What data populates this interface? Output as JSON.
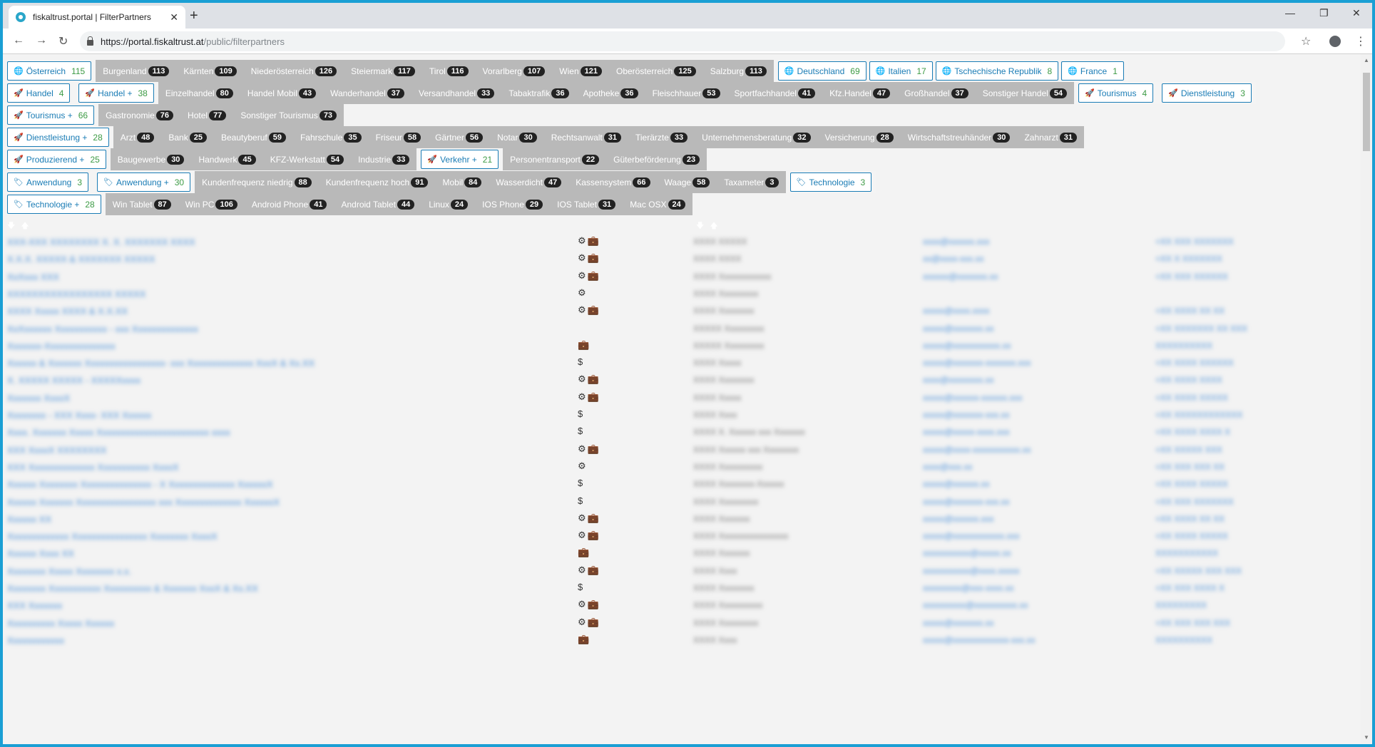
{
  "browser": {
    "tab_title": "fiskaltrust.portal | FilterPartners",
    "url_host": "https://portal.fiskaltrust.at",
    "url_path": "/public/filterpartners"
  },
  "filters": {
    "row1": {
      "oesterreich": {
        "label": "Österreich",
        "count": "115"
      },
      "items": [
        {
          "label": "Burgenland",
          "count": "113"
        },
        {
          "label": "Kärnten",
          "count": "109"
        },
        {
          "label": "Niederösterreich",
          "count": "126"
        },
        {
          "label": "Steiermark",
          "count": "117"
        },
        {
          "label": "Tirol",
          "count": "116"
        },
        {
          "label": "Vorarlberg",
          "count": "107"
        },
        {
          "label": "Wien",
          "count": "121"
        },
        {
          "label": "Oberösterreich",
          "count": "125"
        },
        {
          "label": "Salzburg",
          "count": "113"
        }
      ],
      "countries": [
        {
          "label": "Deutschland",
          "count": "69"
        },
        {
          "label": "Italien",
          "count": "17"
        },
        {
          "label": "Tschechische Republik",
          "count": "8"
        },
        {
          "label": "France",
          "count": "1"
        }
      ]
    },
    "row2": {
      "handel": {
        "label": "Handel",
        "count": "4"
      },
      "handel_plus": {
        "label": "Handel +",
        "count": "38"
      },
      "items": [
        {
          "label": "Einzelhandel",
          "count": "80"
        },
        {
          "label": "Handel Mobil",
          "count": "43"
        },
        {
          "label": "Wanderhandel",
          "count": "37"
        },
        {
          "label": "Versandhandel",
          "count": "33"
        },
        {
          "label": "Tabaktrafik",
          "count": "36"
        },
        {
          "label": "Apotheke",
          "count": "36"
        },
        {
          "label": "Fleischhauer",
          "count": "53"
        },
        {
          "label": "Sportfachhandel",
          "count": "41"
        },
        {
          "label": "Kfz.Handel",
          "count": "47"
        },
        {
          "label": "Großhandel",
          "count": "37"
        },
        {
          "label": "Sonstiger Handel",
          "count": "54"
        }
      ],
      "tourismus": {
        "label": "Tourismus",
        "count": "4"
      },
      "dienstleistung": {
        "label": "Dienstleistung",
        "count": "3"
      }
    },
    "row3": {
      "tourismus_plus": {
        "label": "Tourismus +",
        "count": "66"
      },
      "items": [
        {
          "label": "Gastronomie",
          "count": "76"
        },
        {
          "label": "Hotel",
          "count": "77"
        },
        {
          "label": "Sonstiger Tourismus",
          "count": "73"
        }
      ]
    },
    "row4": {
      "dienstleistung_plus": {
        "label": "Dienstleistung +",
        "count": "28"
      },
      "items": [
        {
          "label": "Arzt",
          "count": "48"
        },
        {
          "label": "Bank",
          "count": "25"
        },
        {
          "label": "Beautyberuf",
          "count": "59"
        },
        {
          "label": "Fahrschule",
          "count": "35"
        },
        {
          "label": "Friseur",
          "count": "58"
        },
        {
          "label": "Gärtner",
          "count": "56"
        },
        {
          "label": "Notar",
          "count": "30"
        },
        {
          "label": "Rechtsanwalt",
          "count": "31"
        },
        {
          "label": "Tierärzte",
          "count": "33"
        },
        {
          "label": "Unternehmensberatung",
          "count": "32"
        },
        {
          "label": "Versicherung",
          "count": "28"
        },
        {
          "label": "Wirtschaftstreuhänder",
          "count": "30"
        },
        {
          "label": "Zahnarzt",
          "count": "31"
        }
      ]
    },
    "row5": {
      "produzierend_plus": {
        "label": "Produzierend +",
        "count": "25"
      },
      "items": [
        {
          "label": "Baugewerbe",
          "count": "30"
        },
        {
          "label": "Handwerk",
          "count": "45"
        },
        {
          "label": "KFZ-Werkstatt",
          "count": "54"
        },
        {
          "label": "Industrie",
          "count": "33"
        }
      ],
      "verkehr_plus": {
        "label": "Verkehr +",
        "count": "21"
      },
      "items2": [
        {
          "label": "Personentransport",
          "count": "22"
        },
        {
          "label": "Güterbeförderung",
          "count": "23"
        }
      ]
    },
    "row6": {
      "anwendung": {
        "label": "Anwendung",
        "count": "3"
      },
      "anwendung_plus": {
        "label": "Anwendung +",
        "count": "30"
      },
      "items": [
        {
          "label": "Kundenfrequenz niedrig",
          "count": "88"
        },
        {
          "label": "Kundenfrequenz hoch",
          "count": "91"
        },
        {
          "label": "Mobil",
          "count": "84"
        },
        {
          "label": "Wasserdicht",
          "count": "47"
        },
        {
          "label": "Kassensystem",
          "count": "66"
        },
        {
          "label": "Waage",
          "count": "58"
        },
        {
          "label": "Taxameter",
          "count": "3"
        }
      ],
      "technologie": {
        "label": "Technologie",
        "count": "3"
      }
    },
    "row7": {
      "technologie_plus": {
        "label": "Technologie +",
        "count": "28"
      },
      "items": [
        {
          "label": "Win Tablet",
          "count": "87"
        },
        {
          "label": "Win PC",
          "count": "106"
        },
        {
          "label": "Android Phone",
          "count": "41"
        },
        {
          "label": "Android Tablet",
          "count": "44"
        },
        {
          "label": "Linux",
          "count": "24"
        },
        {
          "label": "IOS Phone",
          "count": "29"
        },
        {
          "label": "IOS Tablet",
          "count": "31"
        },
        {
          "label": "Mac OSX",
          "count": "24"
        }
      ]
    }
  },
  "icons": {
    "globe": "globe-icon",
    "rocket": "rocket-icon",
    "tag": "tag-icon",
    "gear": "gear-icon",
    "briefcase": "briefcase-icon",
    "dollar": "dollar-icon"
  },
  "colors": {
    "accent": "#1a7cb5",
    "count_green": "#3d9b45",
    "chip_gray": "#b9b9b9",
    "badge_dark": "#222222",
    "frame": "#1a9fd4"
  },
  "partners": [
    {
      "name": "XXX-XXX XXXXXXXX X. X. XXXXXXX XXXX",
      "icons": "⚙💼",
      "city": "XXXX XXXXX",
      "mail": "xxxx@xxxxxx.xxx",
      "tel": "+XX XXX XXXXXXX"
    },
    {
      "name": "X.X.X. XXXXX & XXXXXXX XXXXX",
      "icons": "⚙💼",
      "city": "XXXX XXXX",
      "mail": "xx@xxxx-xxx.xx",
      "tel": "+XX X XXXXXXX"
    },
    {
      "name": "XxXxxx XXX",
      "icons": "⚙💼",
      "city": "XXXX Xxxxxxxxxxxx",
      "mail": "xxxxxx@xxxxxxx.xx",
      "tel": "+XX XXX XXXXXX"
    },
    {
      "name": "XXXXXXXXXXXXXXXXX XXXXX",
      "icons": "⚙",
      "city": "XXXX Xxxxxxxxx",
      "mail": "",
      "tel": ""
    },
    {
      "name": "XXXX Xxxxx XXXX & X.X.XX",
      "icons": "⚙💼",
      "city": "XXXX Xxxxxxxx",
      "mail": "xxxxx@xxxx.xxxx",
      "tel": "+XX XXXX XX XX"
    },
    {
      "name": "XxXxxxxxx Xxxxxxxxxxx - xxx Xxxxxxxxxxxxxx",
      "icons": "",
      "city": "XXXXX Xxxxxxxxx",
      "mail": "xxxxx@xxxxxxx.xx",
      "tel": "+XX XXXXXXX XX XXX"
    },
    {
      "name": "Xxxxxxx-Xxxxxxxxxxxxxxx",
      "icons": "💼",
      "city": "XXXXX Xxxxxxxxx",
      "mail": "xxxxx@xxxxxxxxxxx.xx",
      "tel": "XXXXXXXXXX"
    },
    {
      "name": "Xxxxxx & Xxxxxxx Xxxxxxxxxxxxxxxxx- xxx Xxxxxxxxxxxxxx XxxX & Xx.XX",
      "icons": "$",
      "city": "XXXX Xxxxx",
      "mail": "xxxxx@xxxxxxx-xxxxxxx.xxx",
      "tel": "+XX XXXX XXXXXX"
    },
    {
      "name": "X. XXXXX XXXXX - XXXXXxxxx",
      "icons": "⚙💼",
      "city": "XXXX Xxxxxxxx",
      "mail": "xxxx@xxxxxxxx.xx",
      "tel": "+XX XXXX XXXX"
    },
    {
      "name": "Xxxxxxx XxxxX",
      "icons": "⚙💼",
      "city": "XXXX Xxxxx",
      "mail": "xxxxx@xxxxxx-xxxxxx.xxx",
      "tel": "+XX XXXX XXXXX"
    },
    {
      "name": "Xxxxxxxx - XXX Xxxx- XXX Xxxxxx",
      "icons": "$",
      "city": "XXXX Xxxx",
      "mail": "xxxxx@xxxxxxx-xxx.xx",
      "tel": "+XX XXXXXXXXXXXX"
    },
    {
      "name": "Xxxx. Xxxxxxx Xxxxx Xxxxxxxxxxxxxxxxxxxxxxxx xxxx",
      "icons": "$",
      "city": "XXXX X. Xxxxxx xxx Xxxxxxx",
      "mail": "xxxxx@xxxxx-xxxx.xxx",
      "tel": "+XX XXXX XXXX X"
    },
    {
      "name": "XXX XxxxX XXXXXXXX",
      "icons": "⚙💼",
      "city": "XXXX Xxxxxx xxx Xxxxxxxx",
      "mail": "xxxxx@xxxx-xxxxxxxxxxx.xx",
      "tel": "+XX XXXXX XXX"
    },
    {
      "name": "XXX Xxxxxxxxxxxxxx Xxxxxxxxxxx XxxxX",
      "icons": "⚙",
      "city": "XXXX Xxxxxxxxxx",
      "mail": "xxxx@xxx.xx",
      "tel": "+XX XXX XXX XX"
    },
    {
      "name": "Xxxxxx Xxxxxxxx Xxxxxxxxxxxxxxx - X Xxxxxxxxxxxxxx XxxxxxX",
      "icons": "$",
      "city": "XXXX Xxxxxxxx-Xxxxxx",
      "mail": "xxxxx@xxxxxx.xx",
      "tel": "+XX XXXX XXXXX"
    },
    {
      "name": "Xxxxxx Xxxxxxx Xxxxxxxxxxxxxxxxx xxx Xxxxxxxxxxxxxx XxxxxxX",
      "icons": "$",
      "city": "XXXX Xxxxxxxxx",
      "mail": "xxxxx@xxxxxxx-xxx.xx",
      "tel": "+XX XXX XXXXXXX"
    },
    {
      "name": "Xxxxxx XX",
      "icons": "⚙💼",
      "city": "XXXX Xxxxxxx",
      "mail": "xxxxx@xxxxxx.xxx",
      "tel": "+XX XXXX XX XX"
    },
    {
      "name": "Xxxxxxxxxxxxx Xxxxxxxxxxxxxxxx Xxxxxxxx XxxxX",
      "icons": "⚙💼",
      "city": "XXXX Xxxxxxxxxxxxxxxx",
      "mail": "xxxxx@xxxxxxxxxxxx.xxx",
      "tel": "+XX XXXX XXXXX"
    },
    {
      "name": "Xxxxxx Xxxx XX",
      "icons": "💼",
      "city": "XXXX Xxxxxxx",
      "mail": "xxxxxxxxxxx@xxxxx.xx",
      "tel": "XXXXXXXXXXX"
    },
    {
      "name": "Xxxxxxxx Xxxxx Xxxxxxxx x.x.",
      "icons": "⚙💼",
      "city": "XXXX Xxxx",
      "mail": "xxxxxxxxxxx@xxxx.xxxxx",
      "tel": "+XX XXXXX XXX XXX"
    },
    {
      "name": "Xxxxxxxx Xxxxxxxxxxx Xxxxxxxxxx & Xxxxxxx XxxX & Xx.XX",
      "icons": "$",
      "city": "XXXX Xxxxxxxx",
      "mail": "xxxxxxxxx@xxx-xxxx.xx",
      "tel": "+XX XXX XXXX X"
    },
    {
      "name": "XXX Xxxxxxx",
      "icons": "⚙💼",
      "city": "XXXX Xxxxxxxxxx",
      "mail": "xxxxxxxxxx@xxxxxxxxxx.xx",
      "tel": "XXXXXXXXX"
    },
    {
      "name": "Xxxxxxxxxx Xxxxx Xxxxxx",
      "icons": "⚙💼",
      "city": "XXXX Xxxxxxxxx",
      "mail": "xxxxx@xxxxxxx.xx",
      "tel": "+XX XXX XXX XXX"
    },
    {
      "name": "Xxxxxxxxxxxx",
      "icons": "💼",
      "city": "XXXX Xxxx",
      "mail": "xxxxx@xxxxxxxxxxxxx-xxx.xx",
      "tel": "XXXXXXXXXX"
    }
  ]
}
